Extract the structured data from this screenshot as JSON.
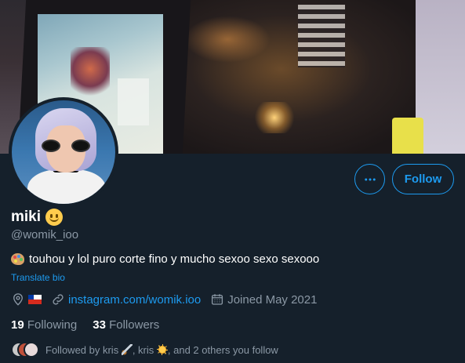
{
  "profile": {
    "display_name": "miki",
    "handle": "@womik_ioo",
    "bio_text": "touhou y lol puro corte fino y mucho sexoo sexo sexooo",
    "translate_label": "Translate bio",
    "website": "instagram.com/womik.ioo",
    "joined": "Joined May 2021",
    "location_icon": "location-pin-icon",
    "location_flag": "chile-flag"
  },
  "actions": {
    "more_icon": "more-dots-icon",
    "follow_label": "Follow"
  },
  "stats": {
    "following_count": "19",
    "following_label": "Following",
    "followers_count": "33",
    "followers_label": "Followers"
  },
  "followed_by": {
    "prefix": "Followed by kris",
    "middle": ", kris",
    "suffix": ", and 2 others you follow"
  },
  "colors": {
    "background": "#15202b",
    "accent": "#1d9bf0",
    "secondary_text": "#8b98a5",
    "primary_text": "#ffffff"
  }
}
